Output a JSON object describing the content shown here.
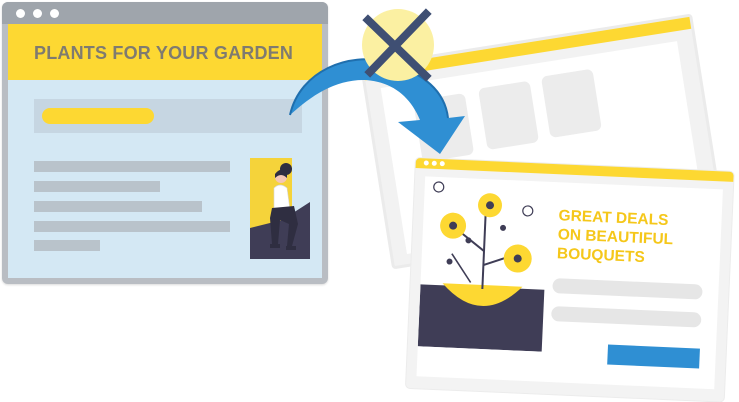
{
  "left_window": {
    "banner_text": "PLANTS FOR YOUR GARDEN"
  },
  "right_window": {
    "headline_lines": [
      "GREAT DEALS",
      "ON BEAUTIFUL",
      "BOUQUETS"
    ]
  },
  "icons": {
    "reject": "x-mark-icon",
    "flow": "curved-arrow-icon"
  },
  "colors": {
    "accent_yellow": "#fdd832",
    "headline_yellow": "#f5c71a",
    "banner_text": "#7f7b70",
    "arrow_blue": "#2f8fd3",
    "panel_blue": "#d4e8f4",
    "dark": "#3f3d56"
  }
}
